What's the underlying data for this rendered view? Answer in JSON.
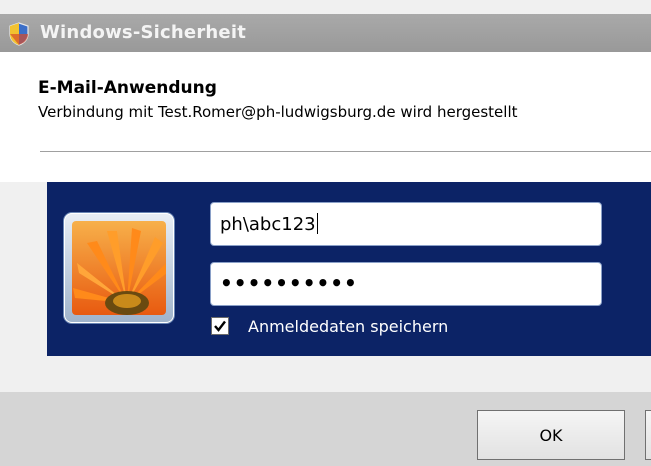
{
  "window": {
    "title": "Windows-Sicherheit",
    "icon": "shield-icon"
  },
  "header": {
    "app_name": "E-Mail-Anwendung",
    "connection_text": "Verbindung mit Test.Romer@ph-ludwigsburg.de wird hergestellt"
  },
  "credentials": {
    "username_value": "ph\\abc123",
    "password_value": "••••••••••",
    "remember_label": "Anmeldedaten speichern",
    "remember_checked": true,
    "avatar_icon": "flower-icon"
  },
  "buttons": {
    "ok_label": "OK"
  },
  "colors": {
    "panel_bg": "#0c2366",
    "titlebar_bg": "#a0a0a0"
  }
}
